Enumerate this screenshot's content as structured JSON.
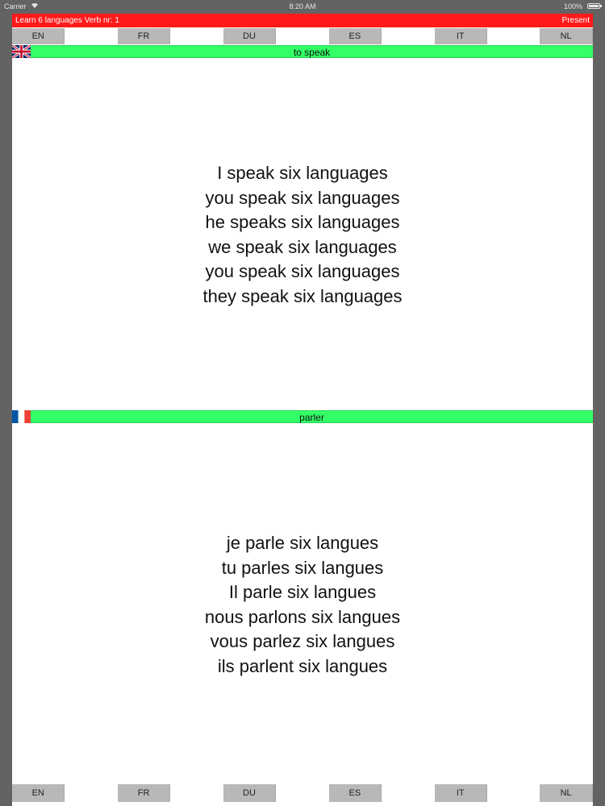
{
  "status_bar": {
    "carrier": "Carrier",
    "time": "8:20 AM",
    "battery": "100%"
  },
  "header": {
    "title": "Learn 6 languages   Verb nr:   1",
    "tense": "Present"
  },
  "languages": [
    "EN",
    "FR",
    "DU",
    "ES",
    "IT",
    "NL"
  ],
  "colors": {
    "title_bar": "#ff1a1a",
    "verb_bar": "#33ff66",
    "lang_button": "#b8b8b8",
    "background": "#636363"
  },
  "panels": [
    {
      "flag": "uk-flag-icon",
      "verb": "to speak",
      "lines": [
        "I speak six languages",
        "you speak six languages",
        "he speaks six languages",
        "we speak six languages",
        "you speak six languages",
        "they speak six languages"
      ]
    },
    {
      "flag": "france-flag-icon",
      "verb": "parler",
      "lines": [
        "je parle six langues",
        "tu parles six langues",
        "Il parle six langues",
        "nous parlons six langues",
        "vous parlez six langues",
        "ils parlent six langues"
      ]
    }
  ]
}
